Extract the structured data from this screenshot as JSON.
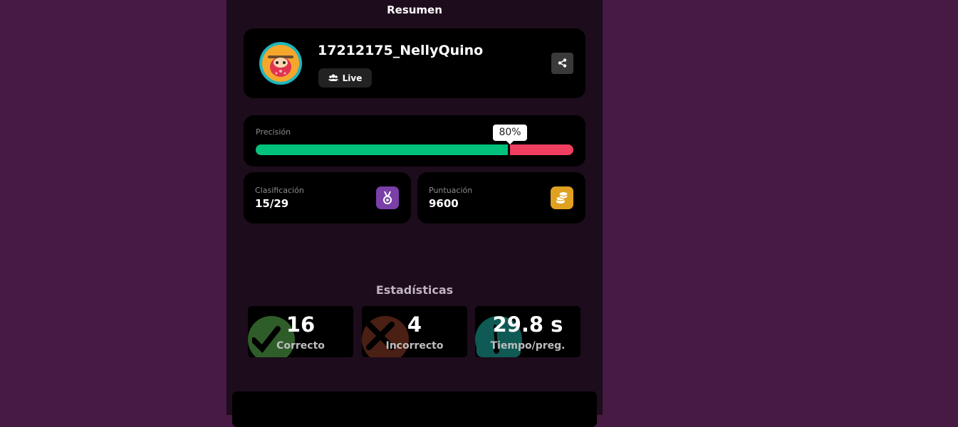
{
  "summary": {
    "title": "Resumen"
  },
  "profile": {
    "username": "17212175_NellyQuino",
    "mode": "Live",
    "avatar_icon": "sloth-avatar-icon",
    "share_icon": "share-icon"
  },
  "accuracy": {
    "label": "Precisión",
    "value_text": "80%",
    "value": 0.8,
    "correct_color": "#00c27c",
    "incorrect_color": "#ef3e5f"
  },
  "rank": {
    "label": "Clasificación",
    "value": "15/29",
    "icon": "medal-icon",
    "color": "#7b3fa8"
  },
  "score": {
    "label": "Puntuación",
    "value": "9600",
    "icon": "coins-icon",
    "color": "#e0a020"
  },
  "stats": {
    "title": "Estadísticas",
    "items": [
      {
        "value": "16",
        "label": "Correcto",
        "icon": "check-icon",
        "color": "#2f5d2a"
      },
      {
        "value": "4",
        "label": "Incorrecto",
        "icon": "cross-icon",
        "color": "#4a1f14"
      },
      {
        "value": "29.8 s",
        "label": "Tiempo/preg.",
        "icon": "timer-icon",
        "color": "#0f5a55"
      }
    ]
  }
}
